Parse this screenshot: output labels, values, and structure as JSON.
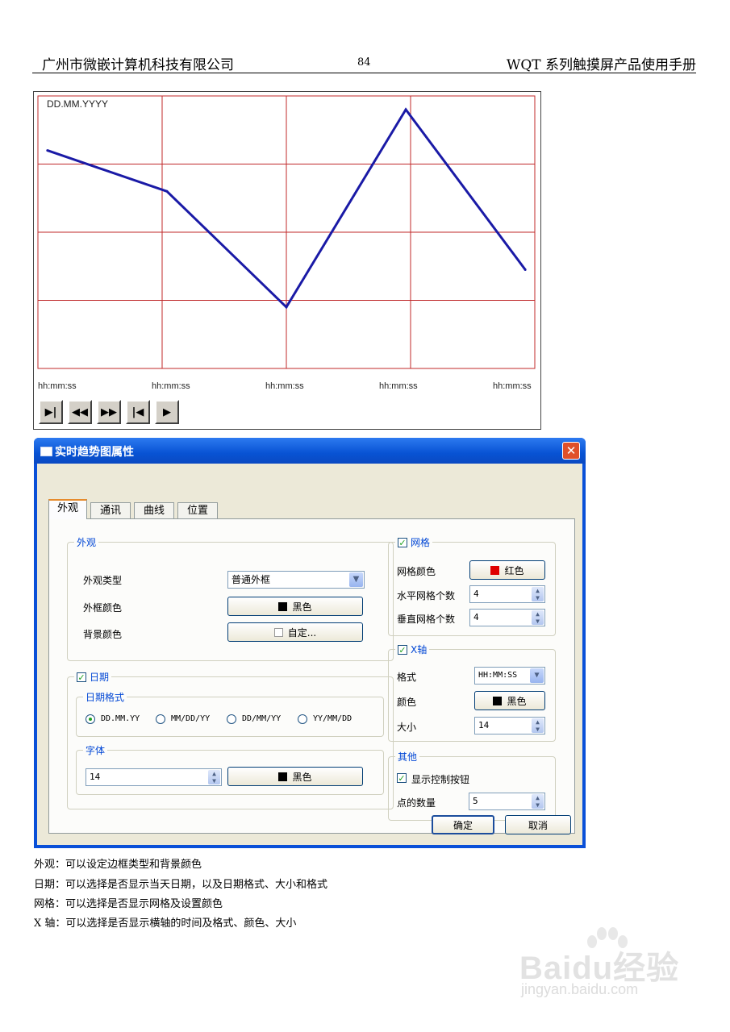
{
  "page_header": {
    "company": "广州市微嵌计算机科技有限公司",
    "page_number": "84",
    "manual_title": "WQT 系列触摸屏产品使用手册"
  },
  "trend_chart": {
    "date_label": "DD.MM.YYYY",
    "time_labels": [
      "hh:mm:ss",
      "hh:mm:ss",
      "hh:mm:ss",
      "hh:mm:ss",
      "hh:mm:ss"
    ],
    "grid_color": "#c0282a",
    "line_color": "#1a1aa6",
    "controls": [
      "play-end-icon",
      "rewind-icon",
      "fast-forward-icon",
      "go-start-icon",
      "play-icon"
    ]
  },
  "chart_data": {
    "type": "line",
    "x": [
      0,
      1,
      2,
      3,
      4
    ],
    "values": [
      3.2,
      2.6,
      0.9,
      3.8,
      1.45
    ],
    "ylim": [
      0,
      4
    ],
    "xlim": [
      -0.08,
      4.08
    ],
    "grid": true,
    "grid_rows": 4,
    "grid_cols": 4
  },
  "dialog": {
    "title": "实时趋势图属性",
    "close_glyph": "✕",
    "tabs": [
      "外观",
      "通讯",
      "曲线",
      "位置"
    ],
    "appearance": {
      "group_title": "外观",
      "type_label": "外观类型",
      "type_value": "普通外框",
      "border_color_label": "外框颜色",
      "border_color_value": "黑色",
      "border_color_hex": "#000000",
      "bg_color_label": "背景颜色",
      "bg_color_value": "自定...",
      "bg_color_hex": "#ffffff"
    },
    "date": {
      "checkbox_label": "日期",
      "checked": true,
      "format_group": "日期格式",
      "formats": [
        "DD.MM.YY",
        "MM/DD/YY",
        "DD/MM/YY",
        "YY/MM/DD"
      ],
      "selected_format": "DD.MM.YY",
      "font_group": "字体",
      "font_size": "14",
      "font_color_value": "黑色",
      "font_color_hex": "#000000"
    },
    "grid": {
      "checkbox_label": "网格",
      "checked": true,
      "color_label": "网格颜色",
      "color_value": "红色",
      "color_hex": "#e00000",
      "h_count_label": "水平网格个数",
      "h_count": "4",
      "v_count_label": "垂直网格个数",
      "v_count": "4"
    },
    "x_axis": {
      "checkbox_label": "X轴",
      "checked": true,
      "format_label": "格式",
      "format_value": "HH:MM:SS",
      "color_label": "颜色",
      "color_value": "黑色",
      "color_hex": "#000000",
      "size_label": "大小",
      "size_value": "14"
    },
    "other": {
      "group_title": "其他",
      "show_controls_label": "显示控制按钮",
      "show_controls_checked": true,
      "points_label": "点的数量",
      "points_value": "5"
    },
    "ok_label": "确定",
    "cancel_label": "取消"
  },
  "descriptions": [
    "外观：可以设定边框类型和背景颜色",
    "日期：可以选择是否显示当天日期，以及日期格式、大小和格式",
    "网格：可以选择是否显示网格及设置颜色",
    "X 轴：可以选择是否显示横轴的时间及格式、颜色、大小"
  ],
  "watermark": {
    "brand": "Baidu经验",
    "url": "jingyan.baidu.com"
  }
}
